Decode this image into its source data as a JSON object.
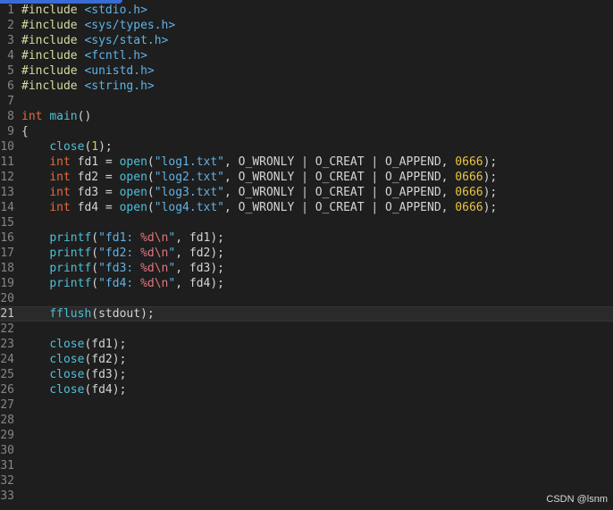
{
  "editor": {
    "lines": [
      {
        "n": "1",
        "tokens": [
          {
            "t": "#include ",
            "c": "pp"
          },
          {
            "t": "<stdio.h>",
            "c": "str"
          }
        ]
      },
      {
        "n": "2",
        "tokens": [
          {
            "t": "#include ",
            "c": "pp"
          },
          {
            "t": "<sys/types.h>",
            "c": "str"
          }
        ]
      },
      {
        "n": "3",
        "tokens": [
          {
            "t": "#include ",
            "c": "pp"
          },
          {
            "t": "<sys/stat.h>",
            "c": "str"
          }
        ]
      },
      {
        "n": "4",
        "tokens": [
          {
            "t": "#include ",
            "c": "pp"
          },
          {
            "t": "<fcntl.h>",
            "c": "str"
          }
        ]
      },
      {
        "n": "5",
        "tokens": [
          {
            "t": "#include ",
            "c": "pp"
          },
          {
            "t": "<unistd.h>",
            "c": "str"
          }
        ]
      },
      {
        "n": "6",
        "tokens": [
          {
            "t": "#include ",
            "c": "pp"
          },
          {
            "t": "<string.h>",
            "c": "str"
          }
        ]
      },
      {
        "n": "7",
        "tokens": []
      },
      {
        "n": "8",
        "tokens": [
          {
            "t": "int",
            "c": "kw"
          },
          {
            "t": " ",
            "c": "id"
          },
          {
            "t": "main",
            "c": "fn"
          },
          {
            "t": "()",
            "c": "id"
          }
        ]
      },
      {
        "n": "9",
        "tokens": [
          {
            "t": "{",
            "c": "id"
          }
        ]
      },
      {
        "n": "10",
        "tokens": [
          {
            "t": "    ",
            "c": "id"
          },
          {
            "t": "close",
            "c": "fn"
          },
          {
            "t": "(",
            "c": "id"
          },
          {
            "t": "1",
            "c": "num"
          },
          {
            "t": ");",
            "c": "id"
          }
        ]
      },
      {
        "n": "11",
        "tokens": [
          {
            "t": "    ",
            "c": "id"
          },
          {
            "t": "int",
            "c": "kw"
          },
          {
            "t": " fd1 = ",
            "c": "id"
          },
          {
            "t": "open",
            "c": "fn"
          },
          {
            "t": "(",
            "c": "id"
          },
          {
            "t": "\"log1.txt\"",
            "c": "str"
          },
          {
            "t": ", O_WRONLY | O_CREAT | O_APPEND, ",
            "c": "id"
          },
          {
            "t": "0666",
            "c": "num"
          },
          {
            "t": ");",
            "c": "id"
          }
        ]
      },
      {
        "n": "12",
        "tokens": [
          {
            "t": "    ",
            "c": "id"
          },
          {
            "t": "int",
            "c": "kw"
          },
          {
            "t": " fd2 = ",
            "c": "id"
          },
          {
            "t": "open",
            "c": "fn"
          },
          {
            "t": "(",
            "c": "id"
          },
          {
            "t": "\"log2.txt\"",
            "c": "str"
          },
          {
            "t": ", O_WRONLY | O_CREAT | O_APPEND, ",
            "c": "id"
          },
          {
            "t": "0666",
            "c": "num"
          },
          {
            "t": ");",
            "c": "id"
          }
        ]
      },
      {
        "n": "13",
        "tokens": [
          {
            "t": "    ",
            "c": "id"
          },
          {
            "t": "int",
            "c": "kw"
          },
          {
            "t": " fd3 = ",
            "c": "id"
          },
          {
            "t": "open",
            "c": "fn"
          },
          {
            "t": "(",
            "c": "id"
          },
          {
            "t": "\"log3.txt\"",
            "c": "str"
          },
          {
            "t": ", O_WRONLY | O_CREAT | O_APPEND, ",
            "c": "id"
          },
          {
            "t": "0666",
            "c": "num"
          },
          {
            "t": ");",
            "c": "id"
          }
        ]
      },
      {
        "n": "14",
        "tokens": [
          {
            "t": "    ",
            "c": "id"
          },
          {
            "t": "int",
            "c": "kw"
          },
          {
            "t": " fd4 = ",
            "c": "id"
          },
          {
            "t": "open",
            "c": "fn"
          },
          {
            "t": "(",
            "c": "id"
          },
          {
            "t": "\"log4.txt\"",
            "c": "str"
          },
          {
            "t": ", O_WRONLY | O_CREAT | O_APPEND, ",
            "c": "id"
          },
          {
            "t": "0666",
            "c": "num"
          },
          {
            "t": ");",
            "c": "id"
          }
        ]
      },
      {
        "n": "15",
        "tokens": []
      },
      {
        "n": "16",
        "tokens": [
          {
            "t": "    ",
            "c": "id"
          },
          {
            "t": "printf",
            "c": "fn"
          },
          {
            "t": "(",
            "c": "id"
          },
          {
            "t": "\"fd1: ",
            "c": "str"
          },
          {
            "t": "%d",
            "c": "pct"
          },
          {
            "t": "\\n",
            "c": "esc"
          },
          {
            "t": "\"",
            "c": "str"
          },
          {
            "t": ", fd1);",
            "c": "id"
          }
        ]
      },
      {
        "n": "17",
        "tokens": [
          {
            "t": "    ",
            "c": "id"
          },
          {
            "t": "printf",
            "c": "fn"
          },
          {
            "t": "(",
            "c": "id"
          },
          {
            "t": "\"fd2: ",
            "c": "str"
          },
          {
            "t": "%d",
            "c": "pct"
          },
          {
            "t": "\\n",
            "c": "esc"
          },
          {
            "t": "\"",
            "c": "str"
          },
          {
            "t": ", fd2);",
            "c": "id"
          }
        ]
      },
      {
        "n": "18",
        "tokens": [
          {
            "t": "    ",
            "c": "id"
          },
          {
            "t": "printf",
            "c": "fn"
          },
          {
            "t": "(",
            "c": "id"
          },
          {
            "t": "\"fd3: ",
            "c": "str"
          },
          {
            "t": "%d",
            "c": "pct"
          },
          {
            "t": "\\n",
            "c": "esc"
          },
          {
            "t": "\"",
            "c": "str"
          },
          {
            "t": ", fd3);",
            "c": "id"
          }
        ]
      },
      {
        "n": "19",
        "tokens": [
          {
            "t": "    ",
            "c": "id"
          },
          {
            "t": "printf",
            "c": "fn"
          },
          {
            "t": "(",
            "c": "id"
          },
          {
            "t": "\"fd4: ",
            "c": "str"
          },
          {
            "t": "%d",
            "c": "pct"
          },
          {
            "t": "\\n",
            "c": "esc"
          },
          {
            "t": "\"",
            "c": "str"
          },
          {
            "t": ", fd4);",
            "c": "id"
          }
        ]
      },
      {
        "n": "20",
        "tokens": []
      },
      {
        "n": "21",
        "current": true,
        "tokens": [
          {
            "t": "    ",
            "c": "id"
          },
          {
            "t": "fflush",
            "c": "fn"
          },
          {
            "t": "(stdout);",
            "c": "id"
          }
        ]
      },
      {
        "n": "22",
        "tokens": []
      },
      {
        "n": "23",
        "tokens": [
          {
            "t": "    ",
            "c": "id"
          },
          {
            "t": "close",
            "c": "fn"
          },
          {
            "t": "(fd1);",
            "c": "id"
          }
        ]
      },
      {
        "n": "24",
        "tokens": [
          {
            "t": "    ",
            "c": "id"
          },
          {
            "t": "close",
            "c": "fn"
          },
          {
            "t": "(fd2);",
            "c": "id"
          }
        ]
      },
      {
        "n": "25",
        "tokens": [
          {
            "t": "    ",
            "c": "id"
          },
          {
            "t": "close",
            "c": "fn"
          },
          {
            "t": "(fd3);",
            "c": "id"
          }
        ]
      },
      {
        "n": "26",
        "tokens": [
          {
            "t": "    ",
            "c": "id"
          },
          {
            "t": "close",
            "c": "fn"
          },
          {
            "t": "(fd4);",
            "c": "id"
          }
        ]
      },
      {
        "n": "27",
        "tokens": []
      },
      {
        "n": "28",
        "tokens": []
      },
      {
        "n": "29",
        "tokens": []
      },
      {
        "n": "30",
        "tokens": []
      },
      {
        "n": "31",
        "tokens": []
      },
      {
        "n": "32",
        "tokens": []
      },
      {
        "n": "33",
        "tokens": []
      }
    ]
  },
  "watermark": {
    "text": "CSDN @lsnm"
  },
  "colors": {
    "background": "#1e1e1e",
    "keyword": "#e06c3b",
    "preprocessor": "#d7dba0",
    "string": "#5fb3e6",
    "function": "#4ec0d8",
    "number": "#e8c44a",
    "escape": "#e0757e",
    "current_line": "#2a2a2a"
  }
}
